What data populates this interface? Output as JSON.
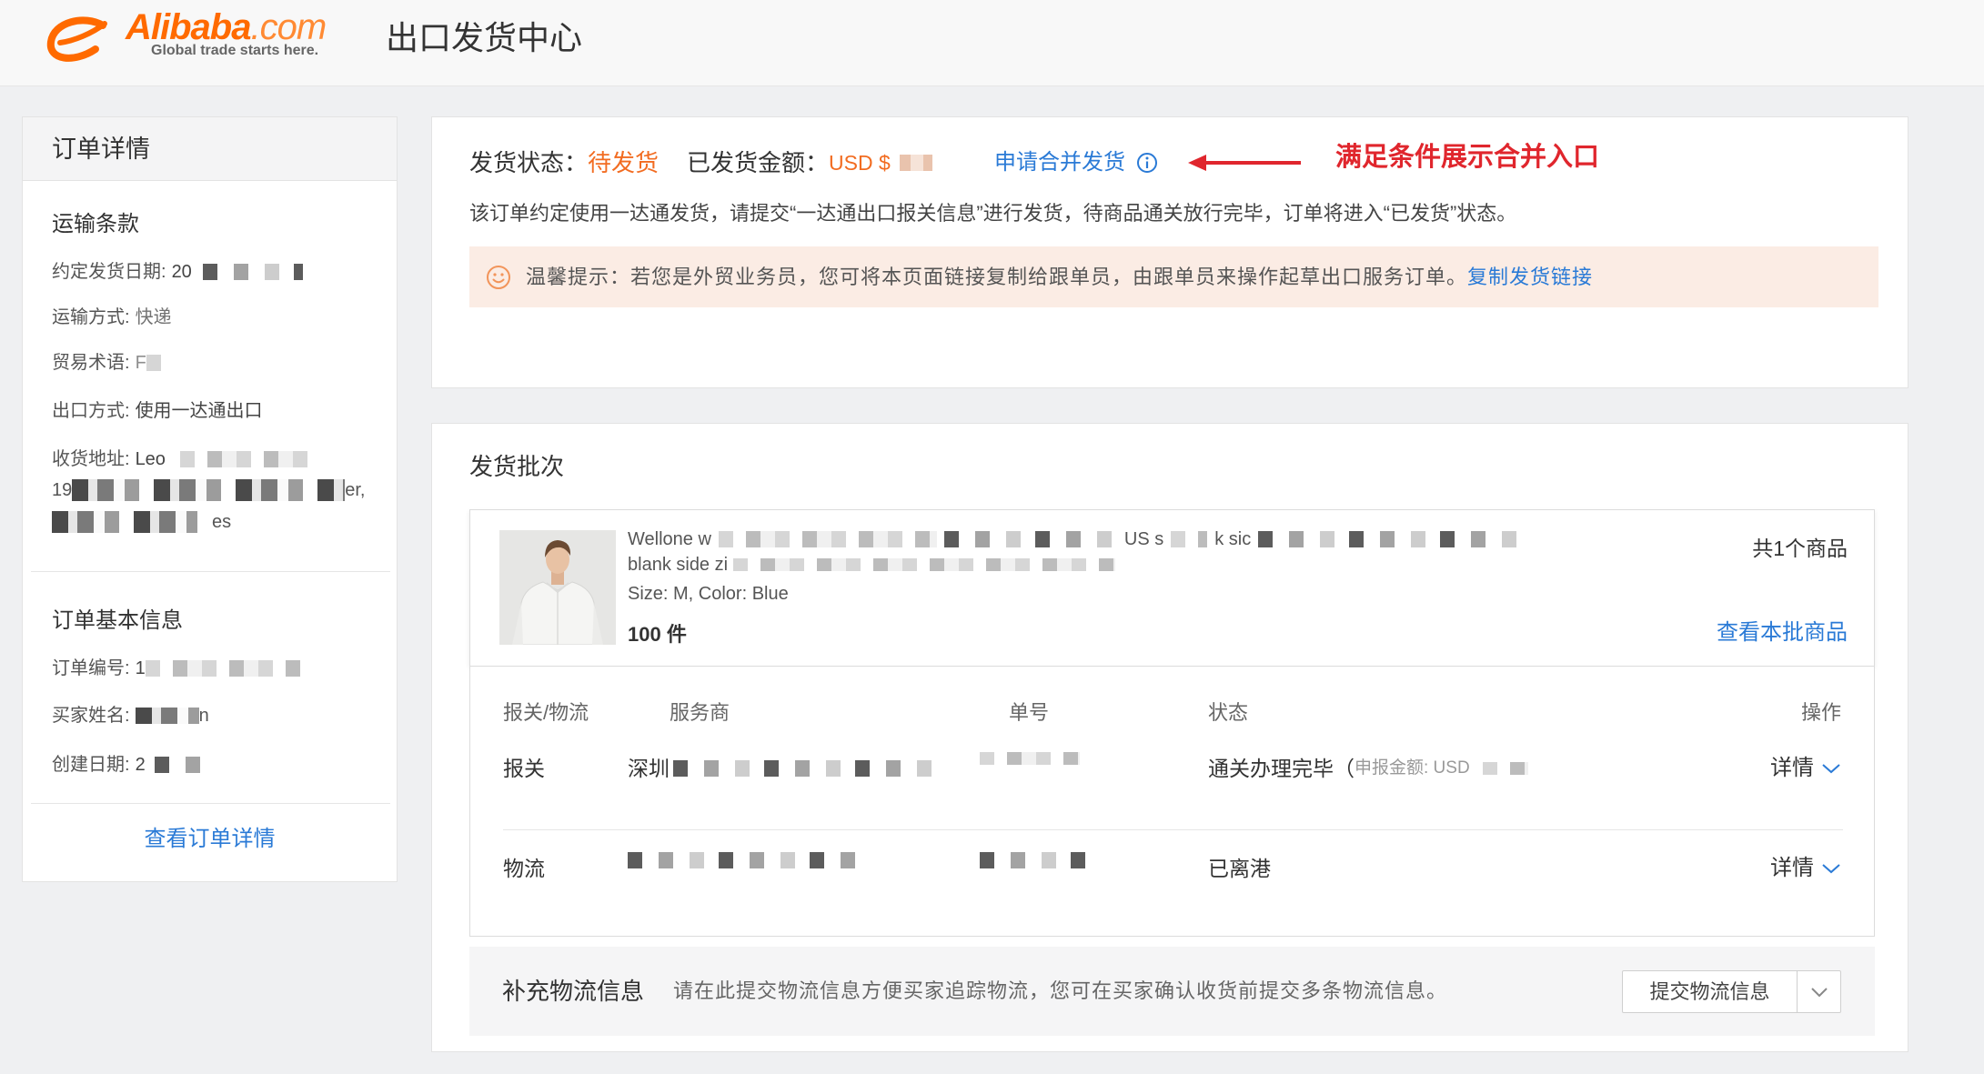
{
  "header": {
    "logo": {
      "brand": "Alibaba",
      "suffix": ".com",
      "tagline": "Global trade starts here."
    },
    "title": "出口发货中心"
  },
  "order_panel": {
    "title": "订单详情",
    "shipping": {
      "heading": "运输条款",
      "delivery_date": {
        "label": "约定发货日期:",
        "value": "20"
      },
      "method": {
        "label": "运输方式:",
        "value": "快递"
      },
      "trade_term": {
        "label": "贸易术语:",
        "value": "F"
      },
      "export_mode": {
        "label": "出口方式:",
        "value": "使用一达通出口"
      },
      "address": {
        "label": "收货地址:",
        "line1": "Leo",
        "line2_start": "19",
        "line2_end": "er,",
        "line3": "es"
      }
    },
    "basic": {
      "heading": "订单基本信息",
      "order_no": {
        "label": "订单编号:",
        "value": "1"
      },
      "buyer": {
        "label": "买家姓名:",
        "value": "n"
      },
      "created": {
        "label": "创建日期:",
        "value": "2"
      }
    },
    "view_link": "查看订单详情"
  },
  "status_panel": {
    "status_label": "发货状态：",
    "status_value": "待发货",
    "amount_label": "已发货金额：",
    "amount_currency": "USD $",
    "merge_link": "申请合并发货",
    "callout": "满足条件展示合并入口",
    "description": "该订单约定使用一达通发货，请提交“一达通出口报关信息”进行发货，待商品通关放行完毕，订单将进入“已发货”状态。",
    "notice": {
      "label": "温馨提示：",
      "text": "若您是外贸业务员，您可将本页面链接复制给跟单员，由跟单员来操作起草出口服务订单。",
      "link": "复制发货链接"
    }
  },
  "batch_panel": {
    "title": "发货批次",
    "product": {
      "title_line1_start": "Wellone w",
      "title_line1_mid": "US s",
      "title_line1_end": "k sic",
      "title_line2": "blank side zi",
      "variant": "Size: M,  Color: Blue",
      "quantity": "100 件",
      "count": "共1个商品",
      "view_link": "查看本批商品"
    },
    "table": {
      "columns": [
        "报关/物流",
        "服务商",
        "单号",
        "状态",
        "操作"
      ],
      "rows": [
        {
          "type": "报关",
          "provider": "深圳",
          "status": "通关办理完毕（",
          "status_note": "申报金额: USD",
          "action": "详情"
        },
        {
          "type": "物流",
          "status": "已离港",
          "action": "详情"
        }
      ]
    },
    "supplement": {
      "title": "补充物流信息",
      "description": "请在此提交物流信息方便买家追踪物流，您可在买家确认收货前提交多条物流信息。",
      "button": "提交物流信息"
    }
  },
  "colors": {
    "accent_orange": "#f26c21",
    "link_blue": "#2a7ad6",
    "callout_red": "#e0262d",
    "notice_bg": "#fbece4"
  },
  "icons": [
    "alibaba-logo-icon",
    "info-icon",
    "arrow-left-icon",
    "smiley-icon",
    "chevron-down-icon"
  ]
}
